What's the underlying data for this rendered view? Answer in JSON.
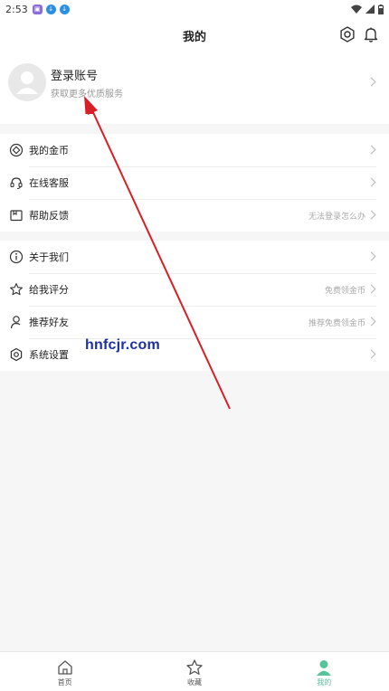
{
  "status_bar": {
    "time": "2:53"
  },
  "header": {
    "title": "我的",
    "settings_icon": "settings-icon",
    "bell_icon": "bell-icon"
  },
  "profile": {
    "name": "登录账号",
    "subtitle": "获取更多优质服务"
  },
  "group1": [
    {
      "label": "我的金币",
      "hint": "",
      "icon": "coin-icon"
    },
    {
      "label": "在线客服",
      "hint": "",
      "icon": "headset-icon"
    },
    {
      "label": "帮助反馈",
      "hint": "无法登录怎么办",
      "icon": "feedback-icon"
    }
  ],
  "group2": [
    {
      "label": "关于我们",
      "hint": "",
      "icon": "info-icon"
    },
    {
      "label": "给我评分",
      "hint": "免费领金币",
      "icon": "star-icon"
    },
    {
      "label": "推荐好友",
      "hint": "推荐免费领金币",
      "icon": "user-icon"
    },
    {
      "label": "系统设置",
      "hint": "",
      "icon": "gear-icon"
    }
  ],
  "watermark": "hnfcjr.com",
  "tabs": [
    {
      "label": "首页",
      "icon": "home-icon"
    },
    {
      "label": "收藏",
      "icon": "star-icon"
    },
    {
      "label": "我的",
      "icon": "person-icon"
    }
  ],
  "colors": {
    "accent": "#58c29a",
    "arrow": "#d61f26",
    "watermark": "#1d2fa6"
  }
}
